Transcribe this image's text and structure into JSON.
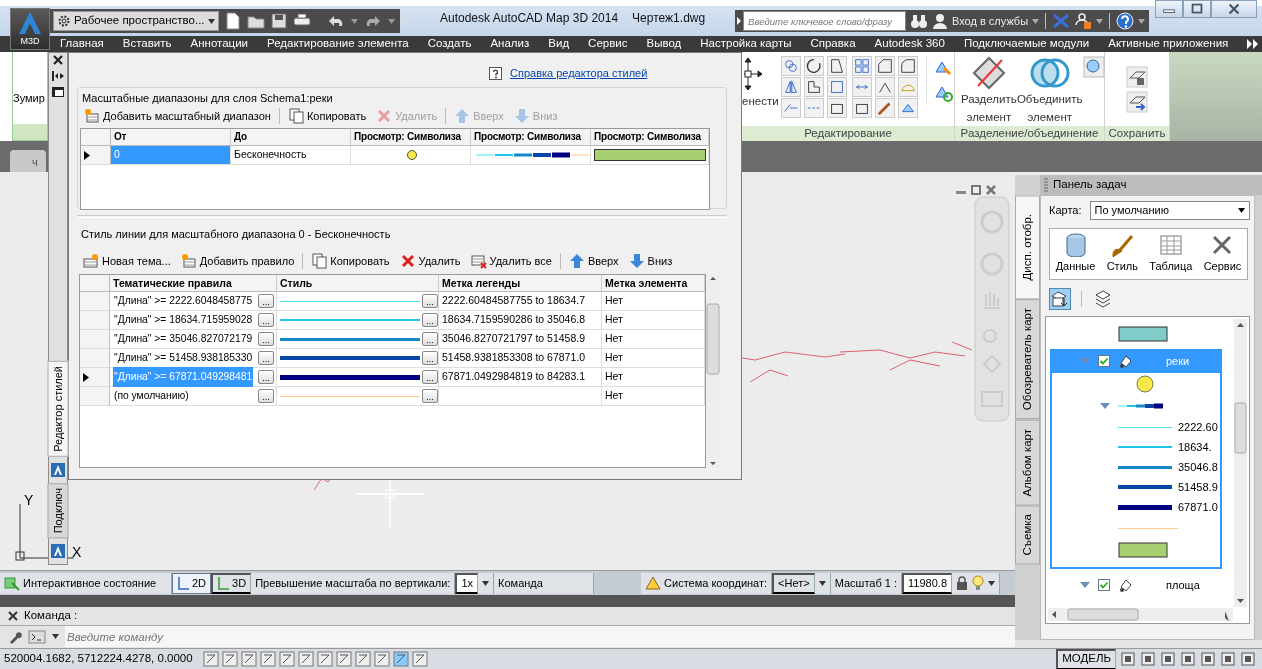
{
  "app": {
    "logo_label": "M3D",
    "workspace": "Рабочее пространство...",
    "title": "Autodesk AutoCAD Map 3D 2014",
    "file": "Чертеж1.dwg",
    "search": {
      "placeholder": "Введите ключевое слово/фразу"
    },
    "signin": "Вход в службы"
  },
  "menu": [
    "Главная",
    "Вставить",
    "Аннотации",
    "Редактирование элемента",
    "Создать",
    "Анализ",
    "Вид",
    "Сервис",
    "Вывод",
    "Настройка карты",
    "Справка",
    "Autodesk 360",
    "Подключаемые модули",
    "Активные приложения"
  ],
  "ribbon": {
    "left_label": "Зумир",
    "move_label": "енести",
    "groups": [
      {
        "label": "Редактирование"
      },
      {
        "label": "Разделение/объединение",
        "buttons": [
          {
            "label": "Разделить элемент",
            "kind": "split"
          },
          {
            "label": "Объединить элемент",
            "kind": "merge"
          }
        ]
      },
      {
        "label": "Сохранить"
      }
    ]
  },
  "file_tab": "ч",
  "drawing": {
    "ucs_y": "Y",
    "ucs_x": "X"
  },
  "style_editor": {
    "side_tabs": [
      {
        "label": "Редактор стилей",
        "selected": true
      },
      {
        "label": "Подключ",
        "selected": false
      }
    ],
    "help_link": "Справка редактора стилей",
    "ranges": {
      "title": "Масштабные диапазоны для слоя Schema1:реки",
      "toolbar": [
        {
          "label": "Добавить масштабный диапазон",
          "kind": "add",
          "disabled": false
        },
        {
          "label": "Копировать",
          "kind": "copy",
          "disabled": false
        },
        {
          "label": "Удалить",
          "kind": "delete",
          "disabled": true
        },
        {
          "label": "Вверх",
          "kind": "up",
          "disabled": true
        },
        {
          "label": "Вниз",
          "kind": "down",
          "disabled": true
        }
      ],
      "columns": [
        "От",
        "До",
        "Просмотр: Символиза",
        "Просмотр: Символиза",
        "Просмотр: Символиза"
      ],
      "rows": [
        {
          "from": "0",
          "to": "Бесконечность",
          "selected": true,
          "symbols": [
            {
              "kind": "point",
              "color": "#f8e848"
            },
            {
              "kind": "line"
            },
            {
              "kind": "polygon",
              "color": "#a8d070"
            }
          ]
        }
      ]
    },
    "rules": {
      "title": "Стиль линии для масштабного диапазона 0 - Бесконечность",
      "toolbar": [
        {
          "label": "Новая тема...",
          "kind": "theme",
          "disabled": false
        },
        {
          "label": "Добавить правило",
          "kind": "add",
          "disabled": false
        },
        {
          "label": "Копировать",
          "kind": "copy",
          "disabled": false
        },
        {
          "label": "Удалить",
          "kind": "delete",
          "disabled": false
        },
        {
          "label": "Удалить все",
          "kind": "delete-all",
          "disabled": false
        },
        {
          "label": "Вверх",
          "kind": "up",
          "disabled": false
        },
        {
          "label": "Вниз",
          "kind": "down",
          "disabled": false
        }
      ],
      "columns": [
        "Тематические правила",
        "Стиль",
        "Метка легенды",
        "Метка элемента"
      ],
      "rows": [
        {
          "rule": "\"Длина\" >= 2222.6048458775",
          "rule_button": "...",
          "color": "#40e8f0",
          "kind": "hairline",
          "style_button": "...",
          "legend": "2222.60484587755 to 18634.7",
          "label": "Нет",
          "selected": false
        },
        {
          "rule": "\"Длина\" >= 18634.715959028",
          "rule_button": "...",
          "color": "#20c4e4",
          "kind": "thin",
          "style_button": "...",
          "legend": "18634.7159590286 to 35046.8",
          "label": "Нет",
          "selected": false
        },
        {
          "rule": "\"Длина\" >= 35046.827072179",
          "rule_button": "...",
          "color": "#1888c8",
          "kind": "medium",
          "style_button": "...",
          "legend": "35046.8270721797 to 51458.9",
          "label": "Нет",
          "selected": false
        },
        {
          "rule": "\"Длина\" >= 51458.938185330",
          "rule_button": "...",
          "color": "#0846a8",
          "kind": "thick",
          "style_button": "...",
          "legend": "51458.9381853308 to 67871.0",
          "label": "Нет",
          "selected": false
        },
        {
          "rule": "\"Длина\" >= 67871.049298481",
          "rule_button": "...",
          "color": "#000080",
          "kind": "heavy",
          "style_button": "...",
          "legend": "67871.0492984819 to 84283.1",
          "label": "Нет",
          "selected": true
        },
        {
          "rule": "(по умолчанию)",
          "rule_button": "...",
          "color": "#ffc890",
          "kind": "hairline",
          "style_button": "...",
          "label": "Нет",
          "selected": false
        }
      ]
    }
  },
  "task_panel": {
    "title": "Панель задач",
    "side_tabs": [
      {
        "label": "Дисп. отобр.",
        "selected": true
      },
      {
        "label": "Обозреватель карт",
        "selected": false
      },
      {
        "label": "Альбом карт",
        "selected": false
      },
      {
        "label": "Съемка",
        "selected": false
      }
    ],
    "map_label": "Карта:",
    "map_value": "По умолчанию",
    "tools": [
      {
        "label": "Данные",
        "kind": "data"
      },
      {
        "label": "Стиль",
        "kind": "style"
      },
      {
        "label": "Таблица",
        "kind": "table"
      },
      {
        "label": "Сервис",
        "kind": "service"
      }
    ],
    "view_modes": [
      {
        "kind": "draw-order",
        "selected": true
      },
      {
        "kind": "groups",
        "selected": false
      }
    ],
    "layers_above": [
      {
        "kind": "polygon",
        "color": "#80ccc8"
      }
    ],
    "layers": [
      {
        "name": "реки",
        "checked": true,
        "selected": true,
        "expanded": true,
        "legend": [
          {
            "kind": "point",
            "color": "#f8e848"
          },
          {
            "kind": "theme",
            "expanded": true,
            "children": [
              {
                "label": "2222.60",
                "color": "#40e8f0",
                "kind": "hairline"
              },
              {
                "label": "18634.",
                "color": "#20c4e4",
                "kind": "thin"
              },
              {
                "label": "35046.8",
                "color": "#1888c8",
                "kind": "medium"
              },
              {
                "label": "51458.9",
                "color": "#0846a8",
                "kind": "thick"
              },
              {
                "label": "67871.0",
                "color": "#000080",
                "kind": "heavy"
              }
            ]
          },
          {
            "kind": "line",
            "color": "#ffc890"
          },
          {
            "kind": "polygon",
            "color": "#a8d070"
          }
        ]
      },
      {
        "name": "площа",
        "checked": true,
        "selected": false,
        "expanded": true
      }
    ]
  },
  "status_bar": {
    "state": "Интерактивное состояние",
    "view_modes": [
      {
        "label": "2D",
        "selected": true
      },
      {
        "label": "3D",
        "selected": false
      }
    ],
    "exaggeration_label": "Превышение масштаба по вертикали:",
    "exaggeration": "1x",
    "command": "Команда",
    "cs_label": "Система координат:",
    "cs": "<Нет>",
    "scale_label": "Масштаб  1 :",
    "scale": "11980.8"
  },
  "command": {
    "label": "Команда :",
    "placeholder": "Введите команду"
  },
  "bottom_bar": {
    "coordinates": "520004.1682, 5712224.4278, 0.0000",
    "model": "МОДЕЛЬ"
  }
}
